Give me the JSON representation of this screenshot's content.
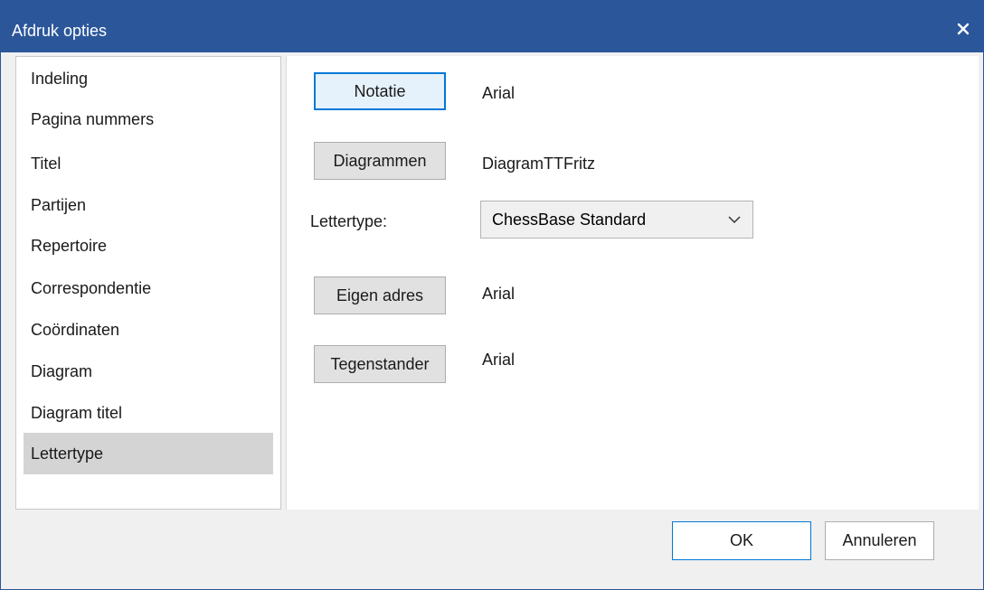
{
  "window": {
    "title": "Afdruk opties",
    "close_icon": "close-icon"
  },
  "sidebar": {
    "items": [
      {
        "label": "Indeling"
      },
      {
        "label": "Pagina nummers"
      },
      {
        "label": "Titel"
      },
      {
        "label": "Partijen"
      },
      {
        "label": "Repertoire"
      },
      {
        "label": "Correspondentie"
      },
      {
        "label": "Coördinaten"
      },
      {
        "label": "Diagram"
      },
      {
        "label": "Diagram titel"
      },
      {
        "label": "Lettertype",
        "selected": true
      }
    ]
  },
  "font_page": {
    "notatie": {
      "button": "Notatie",
      "value": "Arial"
    },
    "diagrammen": {
      "button": "Diagrammen",
      "value": "DiagramTTFritz"
    },
    "lettertype": {
      "label": "Lettertype:",
      "selected": "ChessBase Standard"
    },
    "eigen_adres": {
      "button": "Eigen adres",
      "value": "Arial"
    },
    "tegenstander": {
      "button": "Tegenstander",
      "value": "Arial"
    }
  },
  "footer": {
    "ok": "OK",
    "cancel": "Annuleren"
  },
  "colors": {
    "titlebar": "#2b579a",
    "selected_item": "#d4d4d4",
    "focus": "#0078d7"
  }
}
